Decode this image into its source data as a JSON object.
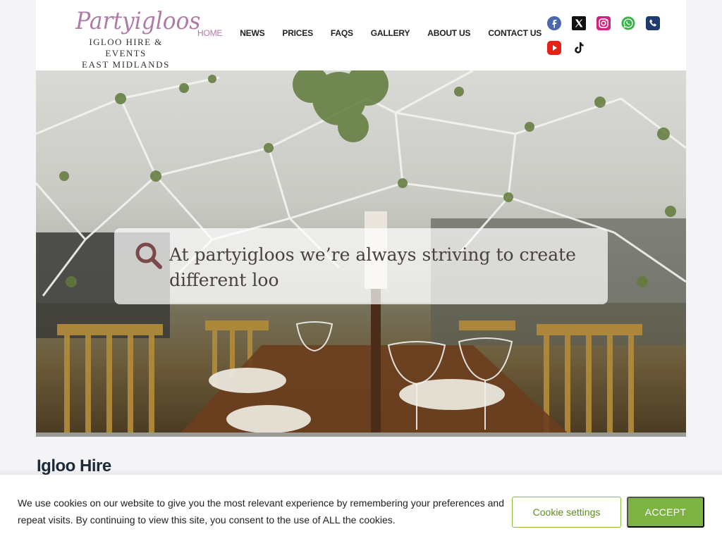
{
  "brand": {
    "script": "Partyigloos",
    "line1": "IGLOO HIRE & EVENTS",
    "line2": "EAST MIDLANDS"
  },
  "nav": {
    "items": [
      {
        "label": "HOME",
        "active": true
      },
      {
        "label": "NEWS"
      },
      {
        "label": "PRICES"
      },
      {
        "label": "FAQS"
      },
      {
        "label": "GALLERY"
      },
      {
        "label": "ABOUT US"
      },
      {
        "label": "CONTACT US"
      }
    ]
  },
  "social": {
    "icons": [
      "facebook-icon",
      "x-twitter-icon",
      "instagram-icon",
      "whatsapp-icon",
      "phone-icon",
      "youtube-icon",
      "tiktok-icon"
    ],
    "colors": {
      "facebook": "#4a67b0",
      "x": "#111111",
      "instagram": "#d6207f",
      "whatsapp": "#3bb34a",
      "phone": "#1e3a6e",
      "youtube": "#e62117",
      "tiktok": "#111111"
    }
  },
  "hero": {
    "search_text": "At partyigloos we’re always striving to create different loo"
  },
  "main": {
    "section_title": "Igloo Hire"
  },
  "cookie": {
    "text": "We use cookies on our website to give you the most relevant experience by remembering your preferences and repeat visits. By continuing to view this site, you consent to the use of ALL the cookies.",
    "settings_label": "Cookie settings",
    "accept_label": "ACCEPT"
  },
  "colors": {
    "accent": "#b07aa6",
    "accept_green": "#7cb342",
    "title": "#1c2a3a"
  }
}
